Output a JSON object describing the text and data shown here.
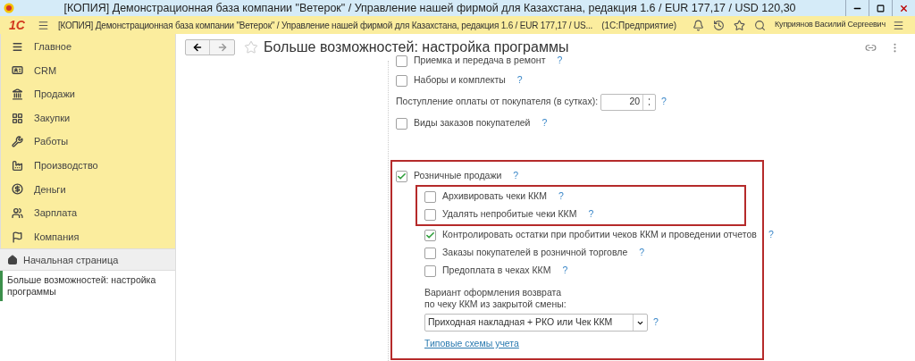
{
  "window": {
    "title": "[КОПИЯ] Демонстрационная база компании \"Ветерок\" / Управление нашей фирмой для Казахстана, редакция 1.6 / EUR 177,17 / USD 120,30"
  },
  "app_bar": {
    "logo": "1С",
    "title": "[КОПИЯ] Демонстрационная база компании \"Ветерок\" / Управление нашей фирмой для Казахстана, редакция 1.6 / EUR 177,17 / US...",
    "platform": "(1С:Предприятие)",
    "user": "Куприянов Василий Сергеевич"
  },
  "sidebar": {
    "sections": [
      {
        "label": "Главное"
      },
      {
        "label": "CRM"
      },
      {
        "label": "Продажи"
      },
      {
        "label": "Закупки"
      },
      {
        "label": "Работы"
      },
      {
        "label": "Производство"
      },
      {
        "label": "Деньги"
      },
      {
        "label": "Зарплата"
      },
      {
        "label": "Компания"
      }
    ],
    "home": "Начальная страница",
    "open_windows": [
      {
        "label": "Больше возможностей: настройка программы",
        "selected": true
      }
    ]
  },
  "page": {
    "title": "Больше возможностей: настройка программы",
    "settings": [
      {
        "kind": "checkbox",
        "label": "Приемка и передача в ремонт",
        "checked": false,
        "help": "?"
      },
      {
        "kind": "checkbox",
        "label": "Наборы и комплекты",
        "checked": false,
        "help": "?"
      },
      {
        "kind": "number",
        "label": "Поступление оплаты от покупателя (в сутках):",
        "value": "20",
        "help": "?"
      },
      {
        "kind": "checkbox",
        "label": "Виды заказов покупателей",
        "checked": false,
        "help": "?"
      }
    ],
    "retail": {
      "label": "Розничные продажи",
      "checked": true,
      "help": "?",
      "highlighted_options": [
        {
          "label": "Архивировать чеки ККМ",
          "checked": false,
          "help": "?"
        },
        {
          "label": "Удалять непробитые чеки ККМ",
          "checked": false,
          "help": "?"
        }
      ],
      "options": [
        {
          "label": "Контролировать остатки при пробитии чеков ККМ и проведении отчетов",
          "checked": true,
          "help": "?"
        },
        {
          "label": "Заказы покупателей в розничной торговле",
          "checked": false,
          "help": "?"
        },
        {
          "label": "Предоплата в чеках ККМ",
          "checked": false,
          "help": "?"
        }
      ],
      "select": {
        "label": "Вариант оформления возврата\nпо чеку ККМ из закрытой смены:",
        "value": "Приходная накладная + РКО или Чек ККМ",
        "help": "?"
      },
      "link": "Типовые схемы учета"
    }
  }
}
